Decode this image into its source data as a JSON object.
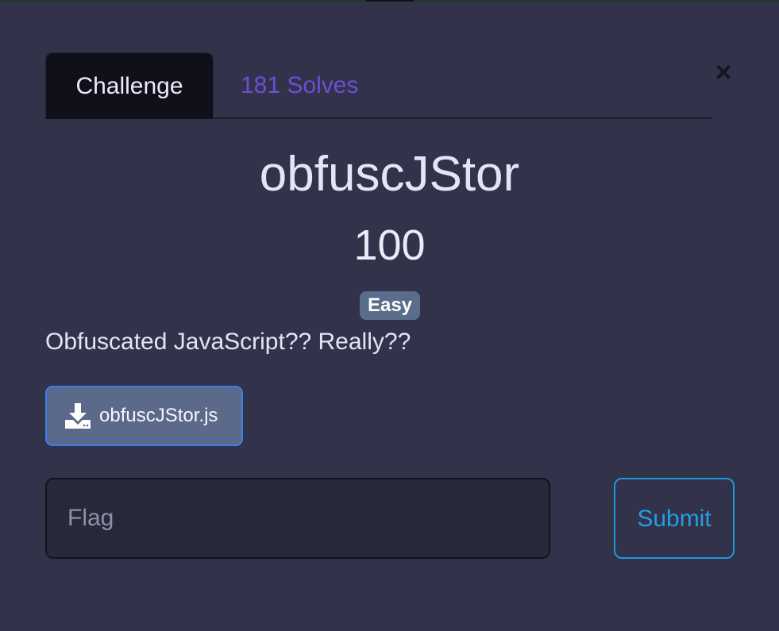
{
  "modal": {
    "close_glyph": "×",
    "tabs": [
      {
        "label": "Challenge",
        "active": true
      },
      {
        "label": "181 Solves",
        "active": false
      }
    ],
    "challenge": {
      "name": "obfuscJStor",
      "points": "100",
      "difficulty": "Easy",
      "description": "Obfuscated JavaScript?? Really??",
      "file": {
        "name": "obfuscJStor.js",
        "icon": "download-icon"
      }
    },
    "flag_form": {
      "value": "",
      "placeholder": "Flag",
      "submit_label": "Submit"
    },
    "colors": {
      "background": "#32324a",
      "active_tab": "#10101a",
      "solves_link": "#6b4fd6",
      "badge": "#5a6d8b",
      "file_button": "#5b6a8a",
      "file_button_border": "#3d7de6",
      "submit": "#239ee0"
    }
  }
}
